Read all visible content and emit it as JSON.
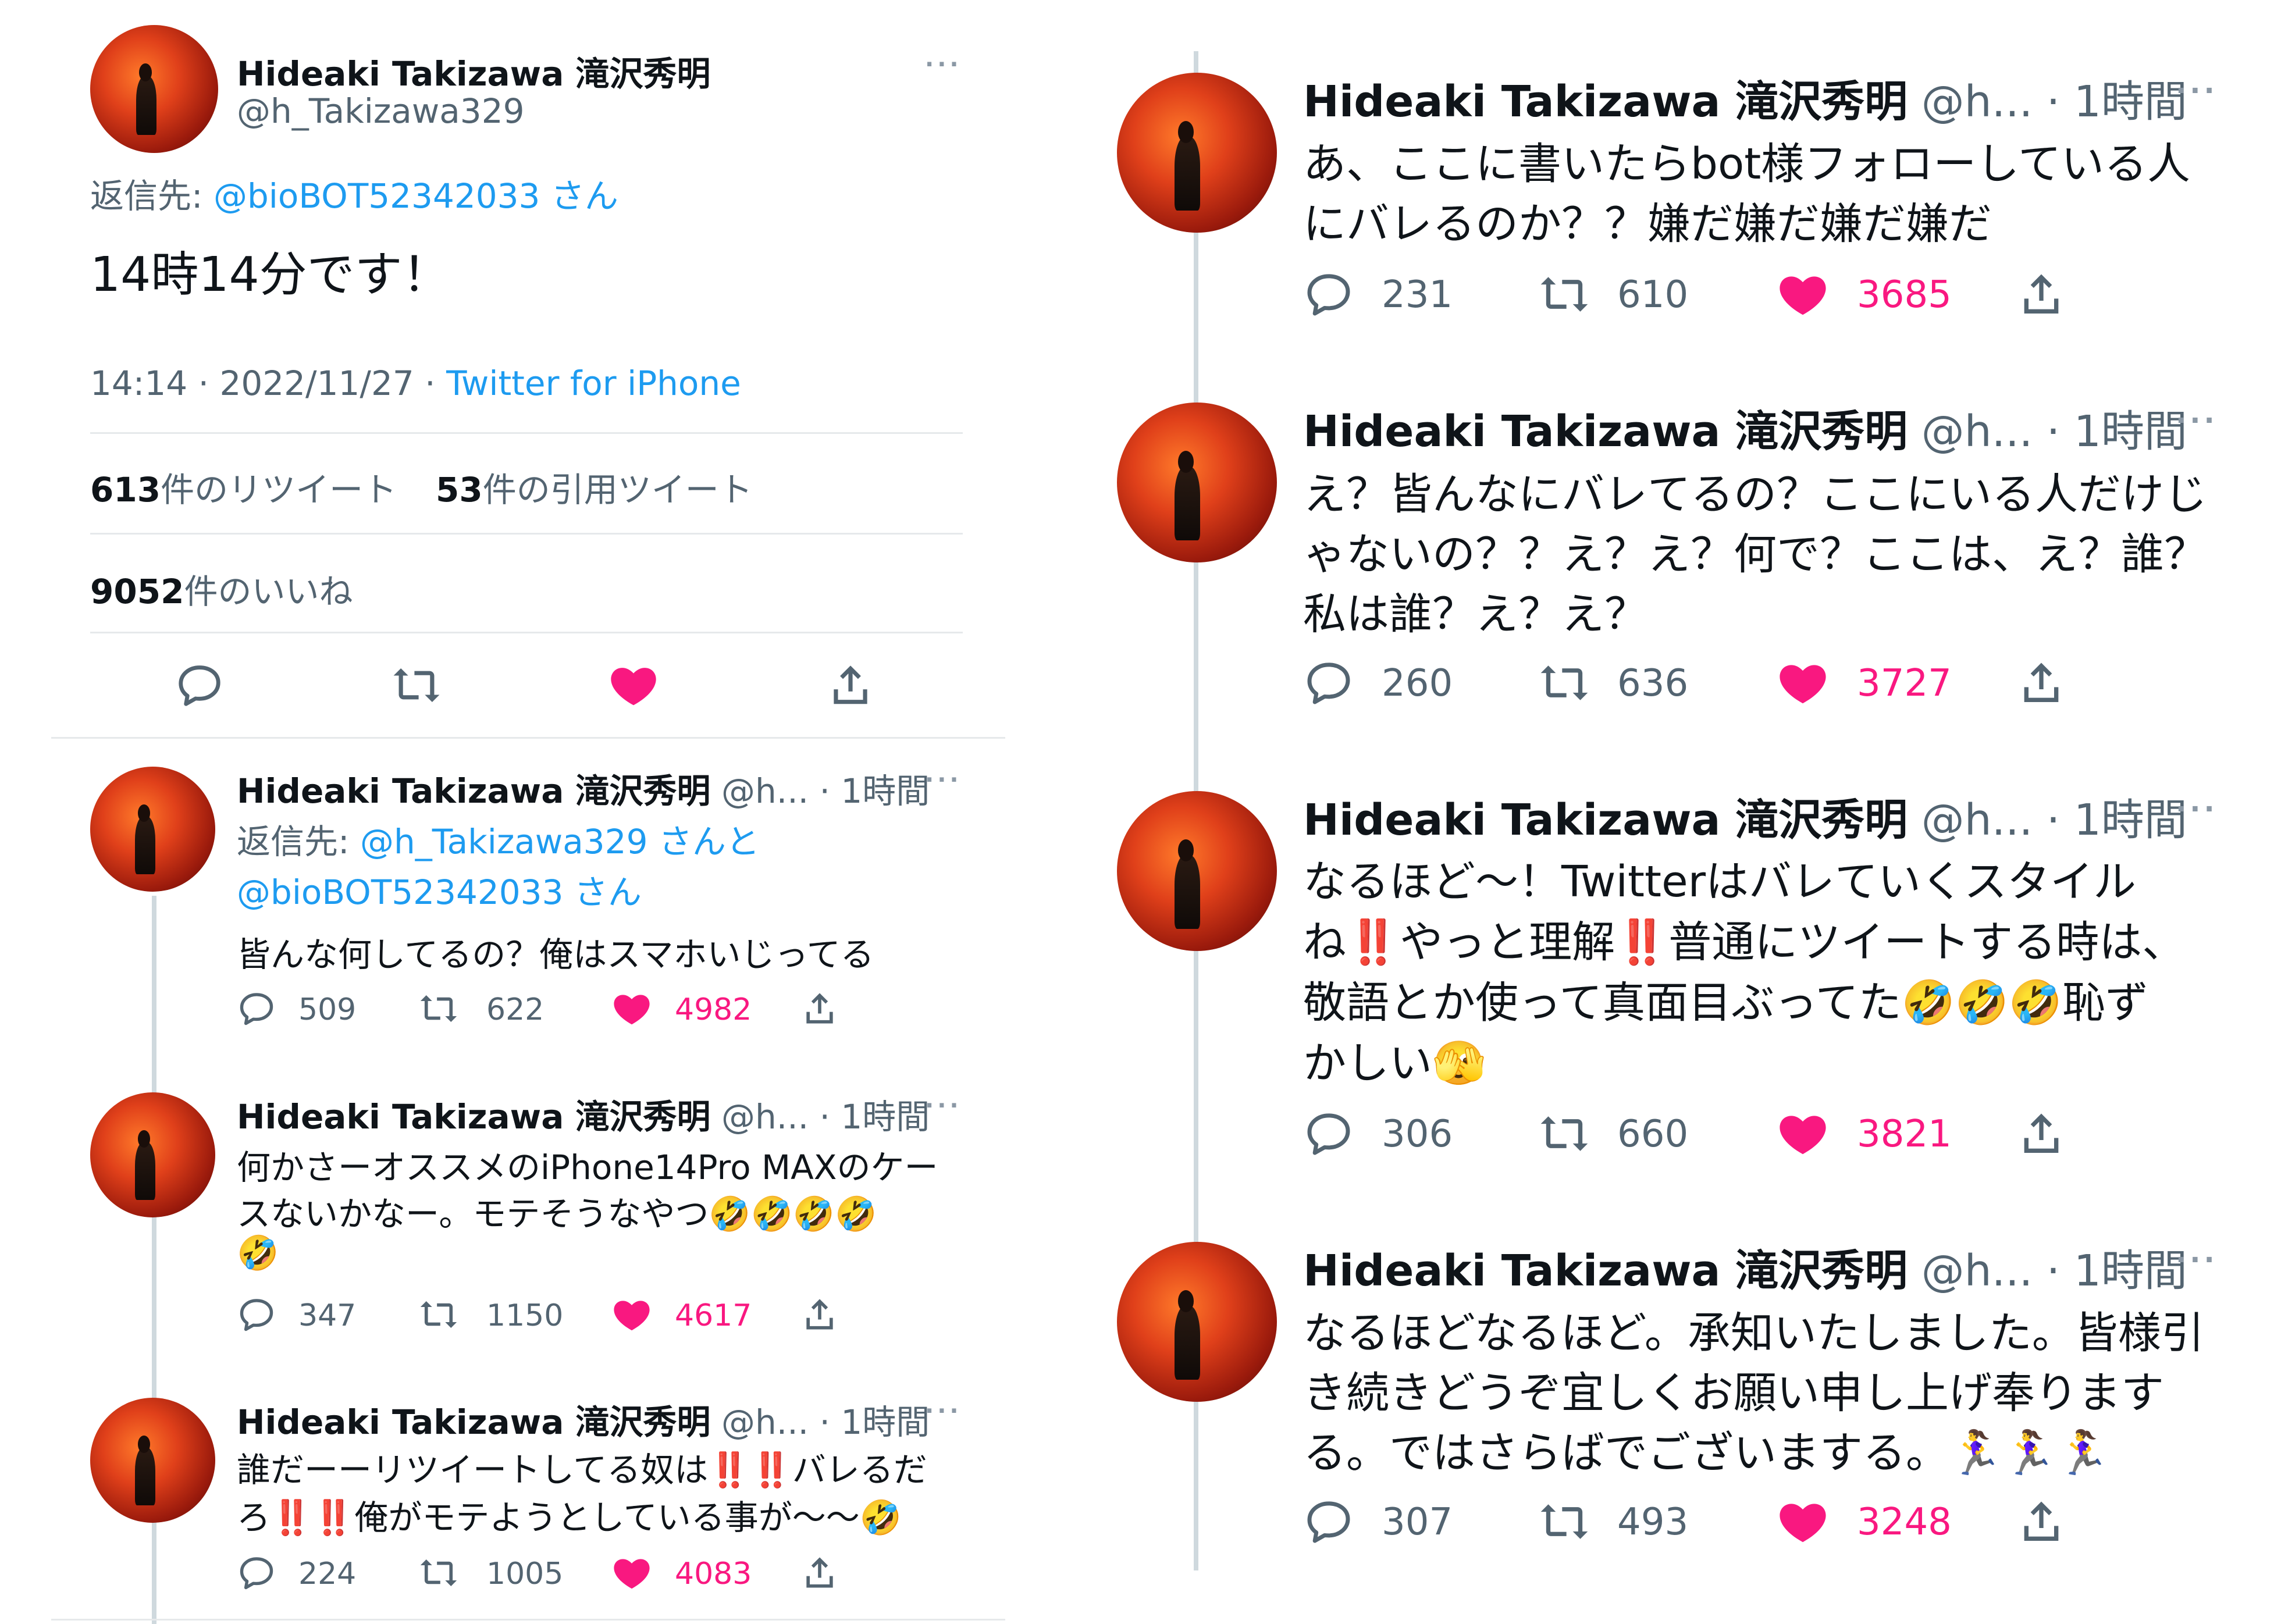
{
  "main_tweet": {
    "name": "Hideaki Takizawa 滝沢秀明",
    "handle": "@h_Takizawa329",
    "reply_prefix": "返信先: ",
    "reply_to": "@bioBOT52342033 さん",
    "text": "14時14分です！",
    "time": "14:14 · 2022/11/27 · ",
    "client": "Twitter for iPhone",
    "retweet_count": "613",
    "retweet_label": "件のリツイート",
    "quote_count": "53",
    "quote_label": "件の引用ツイート",
    "like_count": "9052",
    "like_label": "件のいいね"
  },
  "left_replies": [
    {
      "name": "Hideaki Takizawa 滝沢秀明",
      "meta": "@h... · 1時間",
      "reply_prefix": "返信先: ",
      "reply_to_1": "@h_Takizawa329 さんと",
      "reply_to_2": "@bioBOT52342033 さん",
      "text_1": "皆んな何してるの？俺はスマホいじってる",
      "replies": "509",
      "retweets": "622",
      "likes": "4982"
    },
    {
      "name": "Hideaki Takizawa 滝沢秀明",
      "meta": "@h... · 1時間",
      "text_1": "何かさーオススメのiPhone14Pro MAXのケー",
      "text_2": "スないかなー。モテそうなやつ🤣🤣🤣🤣",
      "text_3": "🤣",
      "replies": "347",
      "retweets": "1150",
      "likes": "4617"
    },
    {
      "name": "Hideaki Takizawa 滝沢秀明",
      "meta": "@h... · 1時間",
      "text_1": "誰だーーリツイートしてる奴は‼️‼️バレるだ",
      "text_2": "ろ‼️‼️俺がモテようとしている事が〜〜🤣",
      "replies": "224",
      "retweets": "1005",
      "likes": "4083"
    }
  ],
  "right_replies": [
    {
      "name": "Hideaki Takizawa 滝沢秀明",
      "meta": "@h... · 1時間",
      "lines": [
        "あ、ここに書いたらbot様フォローしている人",
        "にバレるのか？？嫌だ嫌だ嫌だ嫌だ"
      ],
      "replies": "231",
      "retweets": "610",
      "likes": "3685"
    },
    {
      "name": "Hideaki Takizawa 滝沢秀明",
      "meta": "@h... · 1時間",
      "lines": [
        "え？皆んなにバレてるの？ここにいる人だけじ",
        "ゃないの？？え？え？何で？ここは、え？誰？",
        "私は誰？え？え？"
      ],
      "replies": "260",
      "retweets": "636",
      "likes": "3727"
    },
    {
      "name": "Hideaki Takizawa 滝沢秀明",
      "meta": "@h... · 1時間",
      "lines": [
        "なるほど〜！Twitterはバレていくスタイル",
        "ね‼️やっと理解‼️普通にツイートする時は、",
        "敬語とか使って真面目ぶってた🤣🤣🤣恥ず",
        "かしい🫣"
      ],
      "replies": "306",
      "retweets": "660",
      "likes": "3821"
    },
    {
      "name": "Hideaki Takizawa 滝沢秀明",
      "meta": "@h... · 1時間",
      "lines": [
        "なるほどなるほど。承知いたしました。皆様引",
        "き続きどうぞ宜しくお願い申し上げ奉ります",
        "る。ではさらばでございまする。🏃‍♀️🏃‍♀️🏃‍♀️"
      ],
      "replies": "307",
      "retweets": "493",
      "likes": "3248"
    }
  ],
  "icons": {
    "reply": "reply-icon",
    "retweet": "retweet-icon",
    "like": "heart-icon",
    "share": "share-icon",
    "more": "more-icon"
  },
  "colors": {
    "link": "#1d9bf0",
    "like": "#f91880",
    "text": "#0f1419",
    "secondary": "#536471"
  },
  "more_label": "···"
}
